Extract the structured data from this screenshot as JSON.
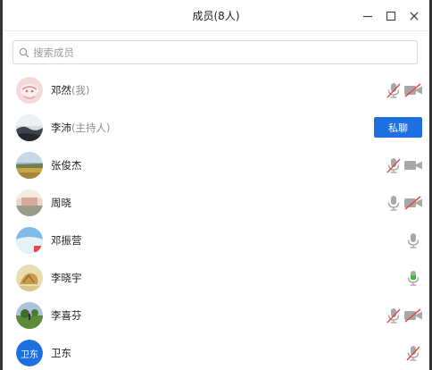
{
  "window": {
    "title": "成员(8人)"
  },
  "search": {
    "placeholder": "搜索成员"
  },
  "members": [
    {
      "name": "邓然",
      "tag": "(我)"
    },
    {
      "name": "李沛",
      "tag": "(主持人)",
      "action": "私聊"
    },
    {
      "name": "张俊杰",
      "tag": ""
    },
    {
      "name": "周晓",
      "tag": ""
    },
    {
      "name": "邓振营",
      "tag": ""
    },
    {
      "name": "李晓宇",
      "tag": ""
    },
    {
      "name": "李喜芬",
      "tag": ""
    },
    {
      "name": "卫东",
      "tag": "",
      "avatar_text": "卫东"
    }
  ],
  "colors": {
    "accent": "#1e6fe0",
    "muted_red": "#e04b4b",
    "active_green": "#35c235"
  }
}
